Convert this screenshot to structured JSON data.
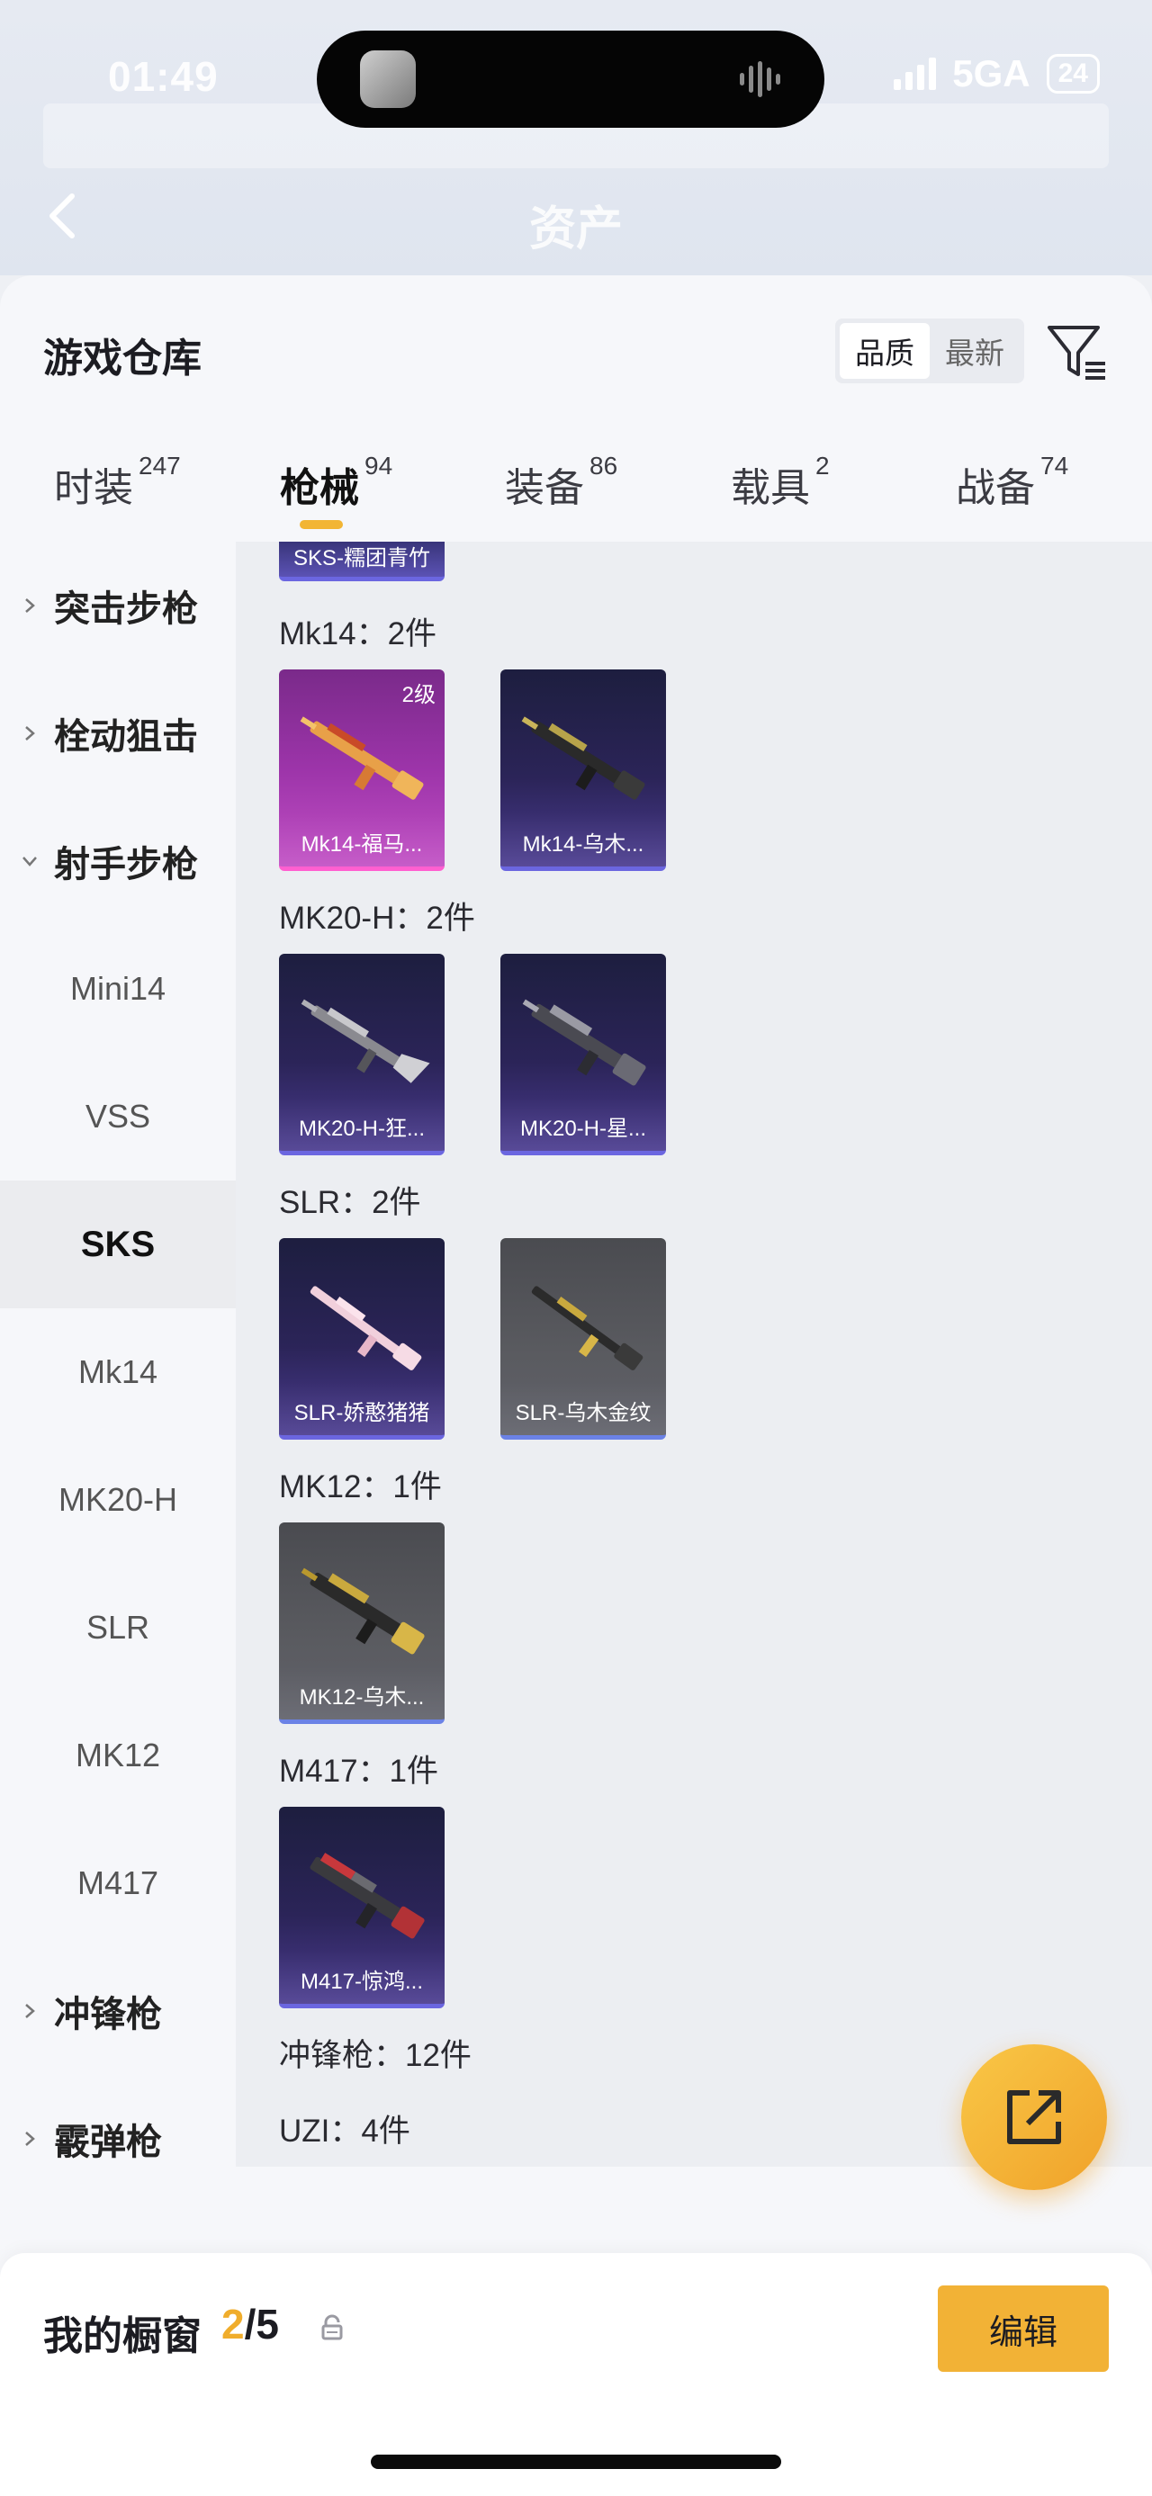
{
  "status_bar": {
    "time": "01:49",
    "network": "5GA",
    "battery": "24"
  },
  "page": {
    "header_title": "资产"
  },
  "warehouse": {
    "title": "游戏仓库",
    "sort": {
      "quality": "品质",
      "newest": "最新"
    }
  },
  "tabs": [
    {
      "label": "时装",
      "count": "247"
    },
    {
      "label": "枪械",
      "count": "94"
    },
    {
      "label": "装备",
      "count": "86"
    },
    {
      "label": "载具",
      "count": "2"
    },
    {
      "label": "战备",
      "count": "74"
    }
  ],
  "nav": {
    "categories": {
      "assault": "突击步枪",
      "bolt": "栓动狙击",
      "marksman": "射手步枪",
      "smg": "冲锋枪",
      "shotgun": "霰弹枪"
    },
    "subs": [
      "Mini14",
      "VSS",
      "SKS",
      "Mk14",
      "MK20-H",
      "SLR",
      "MK12",
      "M417"
    ],
    "selected": "SKS"
  },
  "content": {
    "partial_card": "SKS-糯团青竹",
    "groups": [
      {
        "title": "Mk14：2件",
        "items": [
          {
            "name": "Mk14-福马...",
            "badge": "2级"
          },
          {
            "name": "Mk14-乌木..."
          }
        ]
      },
      {
        "title": "MK20-H：2件",
        "items": [
          {
            "name": "MK20-H-狂..."
          },
          {
            "name": "MK20-H-星..."
          }
        ]
      },
      {
        "title": "SLR：2件",
        "items": [
          {
            "name": "SLR-娇憨猪猪"
          },
          {
            "name": "SLR-乌木金纹"
          }
        ]
      },
      {
        "title": "MK12：1件",
        "items": [
          {
            "name": "MK12-乌木..."
          }
        ]
      },
      {
        "title": "M417：1件",
        "items": [
          {
            "name": "M417-惊鸿..."
          }
        ]
      }
    ],
    "smg_title": "冲锋枪：12件",
    "uzi_title": "UZI：4件"
  },
  "bottom": {
    "label": "我的橱窗",
    "current": "2",
    "total": "/5",
    "edit": "编辑"
  },
  "colors": {
    "accent": "#f2b236",
    "selected_bg": "#ebecef"
  }
}
